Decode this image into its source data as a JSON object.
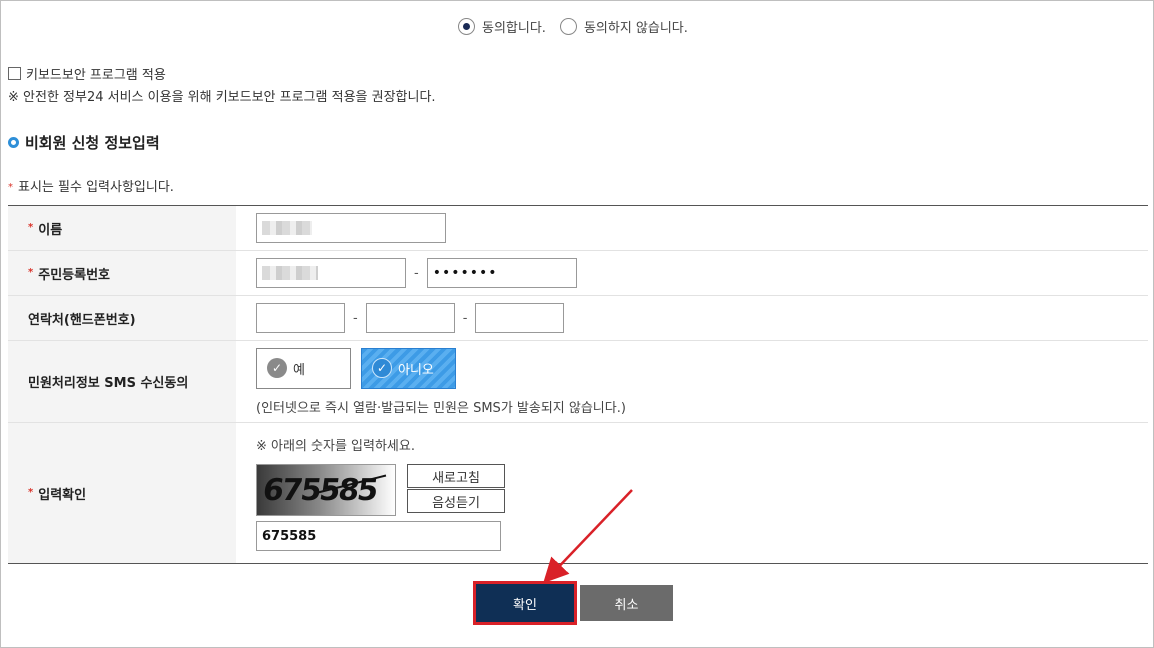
{
  "agreement": {
    "agree_label": "동의합니다.",
    "disagree_label": "동의하지 않습니다.",
    "selected": "agree"
  },
  "keyboard_security": {
    "checkbox_label": "키보드보안 프로그램 적용",
    "checked": false,
    "note": "※ 안전한 정부24 서비스 이용을 위해 키보드보안 프로그램 적용을 권장합니다."
  },
  "section": {
    "title": "비회원 신청 정보입력",
    "required_star": "*",
    "required_note": "표시는 필수 입력사항입니다."
  },
  "form": {
    "name_label": "이름",
    "rrn_label": "주민등록번호",
    "rrn_back_value": "•••••••",
    "rrn_dash": "-",
    "phone_label": "연락처(핸드폰번호)",
    "phone_dash": "-",
    "sms_label": "민원처리정보 SMS 수신동의",
    "sms_yes": "예",
    "sms_no": "아니오",
    "sms_selected": "no",
    "sms_note": "(인터넷으로 즉시 열람·발급되는 민원은 SMS가 발송되지 않습니다.)",
    "captcha_label": "입력확인",
    "captcha_hint": "※ 아래의 숫자를 입력하세요.",
    "captcha_image_text": "675585",
    "refresh_button": "새로고침",
    "audio_button": "음성듣기",
    "captcha_value": "675585",
    "check_glyph": "✓"
  },
  "actions": {
    "confirm": "확인",
    "cancel": "취소"
  },
  "colors": {
    "confirm_bg": "#0f2f55",
    "cancel_bg": "#6b6b6b",
    "highlight": "#d92128",
    "accent": "#2e8fd8"
  }
}
